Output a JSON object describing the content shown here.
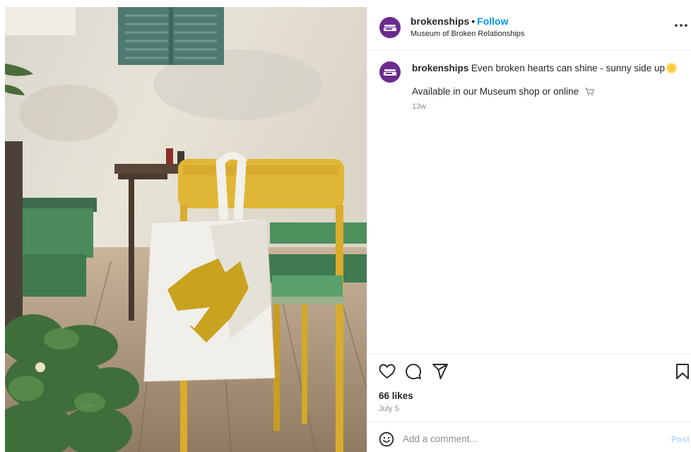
{
  "post": {
    "username": "brokenships",
    "follow_label": "Follow",
    "separator": "•",
    "location": "Museum of Broken Relationships",
    "caption_text": "Even broken hearts can shine - sunny side up",
    "caption_line2": "Available in our Museum shop or online",
    "time_ago": "13w",
    "likes": "66 likes",
    "date": "July 5"
  },
  "comment": {
    "placeholder": "Add a comment...",
    "post_label": "Post"
  },
  "icons": {
    "more": "more-horizontal-icon",
    "like": "heart-icon",
    "comment": "comment-bubble-icon",
    "share": "paper-plane-icon",
    "save": "bookmark-icon",
    "emoji": "smiley-icon"
  },
  "colors": {
    "link": "#0095f6",
    "avatar": "#6b2b8f",
    "post_disabled": "#b3dbff"
  }
}
